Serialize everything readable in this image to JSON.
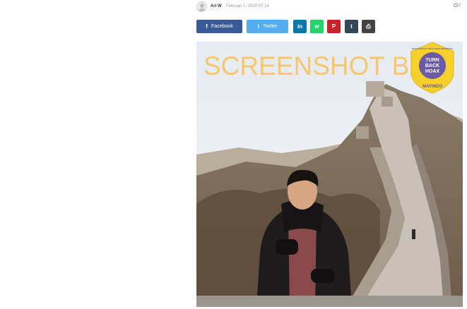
{
  "meta": {
    "author": "Ari W",
    "date": "Februari 1, 2020 07:14",
    "comments": "0"
  },
  "share": {
    "facebook_label": "Facebook",
    "twitter_label": "Twitter",
    "facebook_glyph": "f",
    "twitter_glyph": "t",
    "linkedin_glyph": "in",
    "whatsapp_glyph": "w",
    "pinterest_glyph": "P",
    "tumblr_glyph": "t",
    "print_glyph": "⎙"
  },
  "image": {
    "watermark_text": "SCREENSHOT BY",
    "seal": {
      "top_text": "MASYARAKAT ANTI FITNAH INDONESIA",
      "center_lines": [
        "TURN",
        "BACK",
        "HOAX"
      ],
      "bottom_text": "MAFINDO"
    }
  },
  "colors": {
    "facebook": "#3b5998",
    "twitter": "#55acee",
    "linkedin": "#0e76a8",
    "whatsapp": "#25d366",
    "pinterest": "#cb2027",
    "tumblr": "#35465c",
    "print": "#444444",
    "watermark": "#f6c76d",
    "seal_yellow": "#f5d02b",
    "seal_purple": "#6b5aa6"
  }
}
